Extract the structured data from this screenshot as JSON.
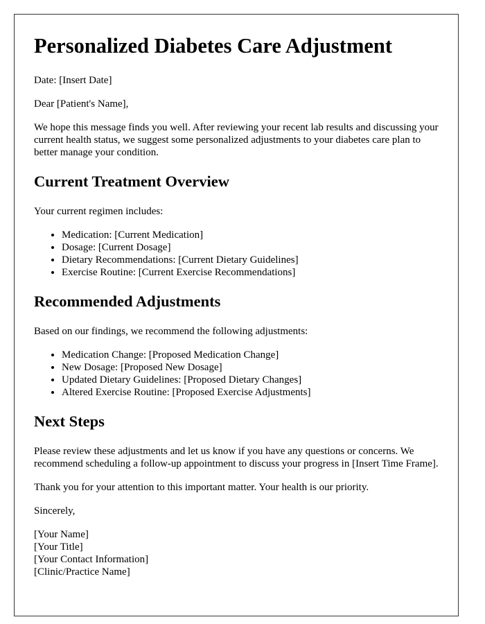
{
  "letter": {
    "title": "Personalized Diabetes Care Adjustment",
    "date_line": "Date: [Insert Date]",
    "salutation": "Dear [Patient's Name],",
    "intro": "We hope this message finds you well. After reviewing your recent lab results and discussing your current health status, we suggest some personalized adjustments to your diabetes care plan to better manage your condition.",
    "sections": [
      {
        "heading": "Current Treatment Overview",
        "lead": "Your current regimen includes:",
        "items": [
          "Medication: [Current Medication]",
          "Dosage: [Current Dosage]",
          "Dietary Recommendations: [Current Dietary Guidelines]",
          "Exercise Routine: [Current Exercise Recommendations]"
        ]
      },
      {
        "heading": "Recommended Adjustments",
        "lead": "Based on our findings, we recommend the following adjustments:",
        "items": [
          "Medication Change: [Proposed Medication Change]",
          "New Dosage: [Proposed New Dosage]",
          "Updated Dietary Guidelines: [Proposed Dietary Changes]",
          "Altered Exercise Routine: [Proposed Exercise Adjustments]"
        ]
      },
      {
        "heading": "Next Steps",
        "paragraphs": [
          "Please review these adjustments and let us know if you have any questions or concerns. We recommend scheduling a follow-up appointment to discuss your progress in [Insert Time Frame].",
          "Thank you for your attention to this important matter. Your health is our priority."
        ]
      }
    ],
    "closing": "Sincerely,",
    "signature": [
      "[Your Name]",
      "[Your Title]",
      "[Your Contact Information]",
      "[Clinic/Practice Name]"
    ]
  },
  "colors": {
    "text": "#000000",
    "border": "#333333",
    "background": "#ffffff"
  }
}
